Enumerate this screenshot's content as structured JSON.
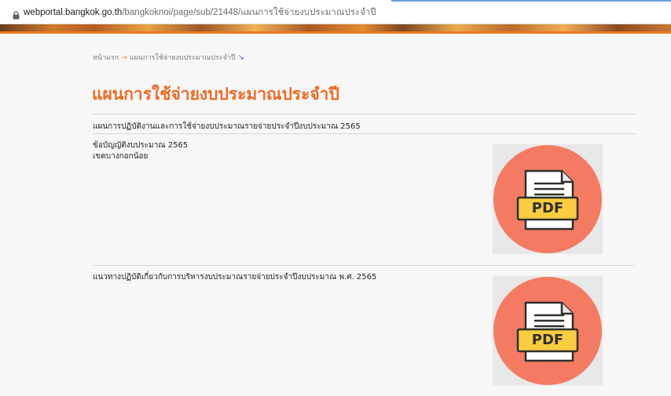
{
  "browser": {
    "url_host": "webportal.bangkok.go.th",
    "url_path": "/bangkoknoi/page/sub/21448/แผนการใช้จ่ายงบประมาณประจำปี"
  },
  "breadcrumb": {
    "home": "หน้าแรก",
    "separator": "→",
    "current": "แผนการใช้จ่ายงบประมาณประจำปี",
    "arrow": "↘"
  },
  "page": {
    "title": "แผนการใช้จ่ายงบประมาณประจำปี"
  },
  "content": {
    "section_heading": "แผนการปฏิบัติงานและการใช้จ่ายงบประมาณรายจ่ายประจำปีงบประมาณ 2565",
    "items": [
      {
        "line1": "ข้อบัญญัติงบประมาณ 2565",
        "line2": "เขตบางกอกน้อย",
        "pdf_label": "PDF"
      },
      {
        "line1": "แนวทางปฏิบัติเกี่ยวกับการบริหารงบประมาณรายจ่ายประจำปีงบประมาณ พ.ศ. 2565",
        "pdf_label": "PDF"
      }
    ]
  },
  "colors": {
    "accent": "#f06a23",
    "pdf_circle": "#f47b62",
    "pdf_label_bg": "#f9cd3f"
  }
}
